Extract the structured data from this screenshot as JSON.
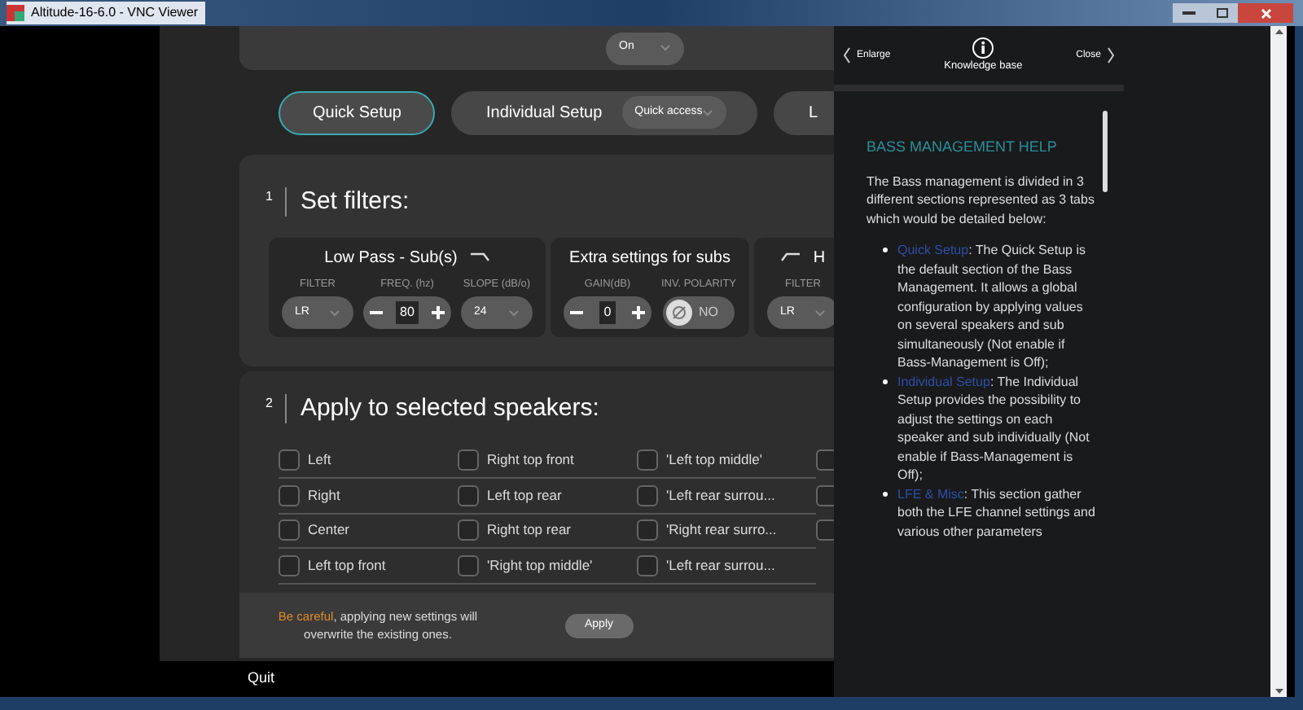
{
  "title_bar": {
    "title": "Altitude-16-6.0 - VNC Viewer"
  },
  "top_card": {
    "dropdown": "On"
  },
  "tabs": [
    {
      "label": "Quick Setup",
      "selected": true
    },
    {
      "label": "Individual Setup",
      "selected": false,
      "dropdown": "Quick access"
    },
    {
      "label": "L",
      "selected": false
    }
  ],
  "set_filters": {
    "number": "1",
    "title": "Set filters:",
    "groups": [
      {
        "title": "Low Pass - Sub(s)",
        "kind": "lowpass",
        "fields": [
          {
            "label": "FILTER",
            "kind": "select",
            "value": "LR"
          },
          {
            "label": "FREQ. (hz)",
            "kind": "stepper",
            "value": "80"
          },
          {
            "label": "SLOPE (dB/o)",
            "kind": "select",
            "value": "24"
          }
        ]
      },
      {
        "title": "Extra settings for subs",
        "kind": "plain",
        "fields": [
          {
            "label": "GAIN(dB)",
            "kind": "stepper",
            "value": "0"
          },
          {
            "label": "INV. POLARITY",
            "kind": "toggle",
            "value": "NO",
            "on": false
          }
        ]
      },
      {
        "title": "H",
        "kind": "highpass",
        "fields": [
          {
            "label": "FILTER",
            "kind": "select",
            "value": "LR"
          }
        ]
      }
    ]
  },
  "speakers": {
    "number": "2",
    "title": "Apply to selected speakers:",
    "rows": [
      [
        {
          "label": "Left",
          "checked": false
        },
        {
          "label": "Right top front",
          "checked": false
        },
        {
          "label": "'Left top middle'",
          "checked": false
        },
        {
          "checked": false
        }
      ],
      [
        {
          "label": "Right",
          "checked": false
        },
        {
          "label": "Left top rear",
          "checked": false
        },
        {
          "label": "'Left rear surrou...",
          "checked": false
        },
        {
          "checked": false
        }
      ],
      [
        {
          "label": "Center",
          "checked": false
        },
        {
          "label": "Right top rear",
          "checked": false
        },
        {
          "label": "'Right rear surro...",
          "checked": false
        },
        {
          "checked": false
        }
      ],
      [
        {
          "label": "Left top front",
          "checked": false
        },
        {
          "label": "'Right top middle'",
          "checked": false
        },
        {
          "label": "'Left rear surrou...",
          "checked": false
        }
      ]
    ]
  },
  "warning": {
    "highlight": "Be careful",
    "text": ", applying new settings will overwrite the existing ones."
  },
  "apply_button": "Apply",
  "quit": "Quit",
  "help": {
    "enlarge": "Enlarge",
    "logo": "Knowledge base",
    "close": "Close",
    "heading": "BASS MANAGEMENT HELP",
    "intro": "The Bass management is divided in 3 different sections represented as 3 tabs which would be detailed below:",
    "bullets": [
      {
        "link": "Quick Setup",
        "text": ": The Quick Setup is the default section of the Bass Management. It allows a global configuration by applying values on several speakers and sub simultaneously (Not enable if Bass-Management is Off);"
      },
      {
        "link": "Individual Setup",
        "text": ": The Individual Setup provides the possibility to adjust the settings on each speaker and sub individually (Not enable if Bass-Management is Off);"
      },
      {
        "link": "LFE & Misc",
        "text": ": This section gather both the LFE channel settings and various other parameters"
      }
    ]
  }
}
